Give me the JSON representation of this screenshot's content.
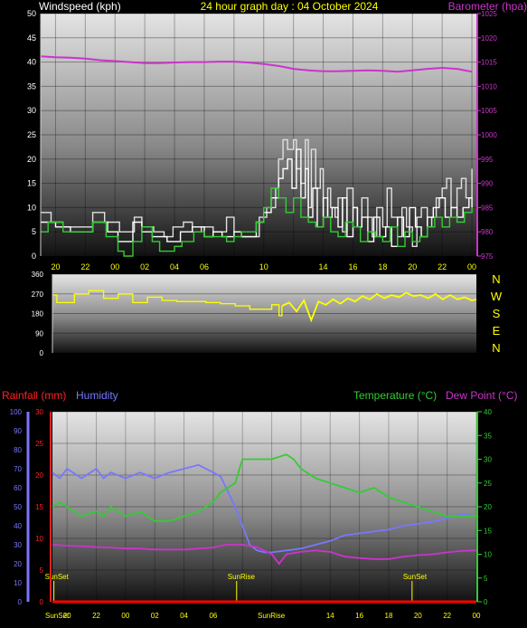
{
  "header": {
    "windspeed_label": "Windspeed (kph)",
    "title": "24 hour graph day : 04 October 2024",
    "barometer_label": "Barometer (hpa)"
  },
  "bottom_header": {
    "rainfall_label": "Rainfall (mm)",
    "humidity_label": "Humidity",
    "temperature_label": "Temperature (°C)",
    "dewpoint_label": "Dew Point (°C)"
  },
  "colors": {
    "windspeed": "#ffffff",
    "gust": "#e0e0e0",
    "avg_wind": "#33cc33",
    "barometer": "#cc33cc",
    "direction": "#ffff00",
    "rainfall": "#ff0000",
    "humidity": "#7777ff",
    "temperature": "#33cc33",
    "dewpoint": "#cc33cc",
    "tick_text": "#ffff00"
  },
  "compass": [
    "N",
    "W",
    "S",
    "E",
    "N"
  ],
  "annotations": {
    "sunset1": "SunSet",
    "sunrise": "SunRise",
    "sunset2": "SunSet"
  },
  "chart_data": [
    {
      "type": "line",
      "name": "wind-chart",
      "title": "24 hour graph day : 04 October 2024",
      "ylabel": "Windspeed (kph)",
      "y2label": "Barometer (hpa)",
      "ylim": [
        0,
        50
      ],
      "y2lim": [
        975,
        1025
      ],
      "yticks": [
        0,
        5,
        10,
        15,
        20,
        25,
        30,
        35,
        40,
        45,
        50
      ],
      "y2ticks": [
        975,
        980,
        985,
        990,
        995,
        1000,
        1005,
        1010,
        1015,
        1020,
        1025
      ],
      "xlim": [
        19,
        43
      ],
      "xticks": [
        {
          "x": 20,
          "label": "20"
        },
        {
          "x": 22,
          "label": "22"
        },
        {
          "x": 24,
          "label": "00"
        },
        {
          "x": 26,
          "label": "02"
        },
        {
          "x": 28,
          "label": "04"
        },
        {
          "x": 30,
          "label": "06"
        },
        {
          "x": 32,
          "label": "08"
        },
        {
          "x": 34,
          "label": "10"
        },
        {
          "x": 36,
          "label": "12"
        },
        {
          "x": 38,
          "label": "14"
        },
        {
          "x": 40,
          "label": "16"
        },
        {
          "x": 42,
          "label": "18"
        },
        {
          "x": 44,
          "label": "20"
        },
        {
          "x": 46,
          "label": "22"
        },
        {
          "x": 48,
          "label": "00"
        }
      ],
      "grid": true,
      "series": [
        {
          "key": "gust",
          "axis": "y",
          "step": true,
          "x": [
            19,
            19.7,
            20.5,
            22.5,
            23.3,
            24.3,
            25.3,
            25.8,
            26.6,
            27.3,
            27.9,
            28.6,
            29.2,
            29.8,
            30.6,
            31.5,
            32,
            32.5,
            33.7,
            34.2,
            34.8,
            35,
            35.3,
            35.6,
            36,
            36.2,
            36.5,
            36.8,
            37,
            37.2,
            37.5,
            37.8,
            38,
            38.3,
            38.5,
            38.8,
            39,
            39.3,
            39.6,
            40,
            40.3,
            40.6,
            41,
            41.3,
            41.6,
            42,
            42.3,
            42.6,
            43,
            43.3,
            43.6,
            44,
            44.3,
            44.6,
            45,
            45.3,
            45.6,
            46,
            46.3,
            46.6,
            47,
            47.3,
            47.6,
            48
          ],
          "y": [
            9,
            7,
            6,
            9,
            7,
            5,
            8,
            6,
            5,
            4,
            6,
            7,
            5,
            6,
            5,
            8,
            5,
            4,
            8,
            10,
            14,
            20,
            24,
            22,
            24,
            18,
            15,
            24,
            10,
            22,
            14,
            18,
            8,
            14,
            10,
            8,
            12,
            5,
            14,
            10,
            6,
            12,
            8,
            4,
            10,
            6,
            14,
            8,
            4,
            10,
            6,
            2,
            8,
            10,
            6,
            8,
            12,
            14,
            16,
            10,
            14,
            16,
            12,
            18
          ]
        },
        {
          "key": "windspeed",
          "axis": "y",
          "step": true,
          "x": [
            19,
            20,
            21,
            22.5,
            23.5,
            24.2,
            25.2,
            25.8,
            26.5,
            27.5,
            28.4,
            29.2,
            30,
            30.6,
            31.2,
            32,
            32.5,
            33.5,
            34,
            34.5,
            35,
            35.3,
            35.6,
            35.9,
            36.2,
            36.5,
            36.8,
            37,
            37.3,
            37.6,
            38,
            38.3,
            38.6,
            39,
            39.3,
            39.6,
            40,
            40.3,
            40.6,
            41,
            41.4,
            41.8,
            42.2,
            42.6,
            43,
            43.4,
            43.8,
            44.2,
            44.6,
            45,
            45.4,
            45.8,
            46.2,
            46.6,
            47,
            47.4,
            47.8,
            48
          ],
          "y": [
            7,
            6,
            5,
            7,
            5,
            3,
            7,
            5,
            4,
            3,
            5,
            6,
            4,
            5,
            4,
            5,
            4,
            7,
            9,
            12,
            16,
            18,
            20,
            14,
            22,
            12,
            18,
            8,
            14,
            6,
            12,
            8,
            10,
            6,
            12,
            4,
            10,
            6,
            8,
            3,
            8,
            4,
            6,
            2,
            8,
            4,
            10,
            6,
            4,
            8,
            10,
            12,
            8,
            10,
            8,
            10,
            12,
            10
          ]
        },
        {
          "key": "avg_wind",
          "axis": "y",
          "step": true,
          "x": [
            19,
            19.5,
            20.5,
            22.5,
            23.4,
            24.2,
            24.6,
            25.2,
            25.8,
            26.5,
            27,
            28,
            28.5,
            29.3,
            30,
            31.5,
            32,
            32.5,
            33.5,
            34,
            34.5,
            35,
            35.5,
            36,
            36.5,
            37,
            37.5,
            38,
            38.5,
            39,
            39.5,
            40,
            40.5,
            41,
            41.5,
            42,
            42.5,
            43,
            43.5,
            44,
            44.5,
            45,
            45.5,
            46,
            46.5,
            47,
            47.5,
            48
          ],
          "y": [
            5,
            7,
            5,
            7,
            4,
            1,
            0,
            3,
            6,
            3,
            1,
            2,
            3,
            5,
            4,
            3,
            4,
            5,
            7,
            10,
            14,
            12,
            9,
            12,
            8,
            7,
            6,
            8,
            5,
            4,
            7,
            6,
            3,
            5,
            4,
            3,
            6,
            2,
            5,
            3,
            4,
            6,
            8,
            6,
            8,
            7,
            9,
            10
          ]
        },
        {
          "key": "barometer",
          "axis": "y2",
          "x": [
            19,
            20,
            21,
            22,
            23,
            24,
            25,
            26,
            27,
            28,
            29,
            30,
            31,
            32,
            33,
            34,
            35,
            36,
            37,
            38,
            39,
            40,
            41,
            42,
            43,
            44,
            45,
            46,
            47,
            48
          ],
          "y": [
            1016.2,
            1016.0,
            1015.9,
            1015.7,
            1015.4,
            1015.2,
            1015.0,
            1014.8,
            1014.8,
            1014.9,
            1015.0,
            1015.0,
            1015.1,
            1015.1,
            1014.9,
            1014.6,
            1014.2,
            1013.6,
            1013.3,
            1013.1,
            1013.1,
            1013.2,
            1013.3,
            1013.2,
            1013.0,
            1013.3,
            1013.6,
            1013.8,
            1013.6,
            1013.0
          ]
        }
      ]
    },
    {
      "type": "line",
      "name": "direction-chart",
      "ylim": [
        0,
        360
      ],
      "yticks": [
        0,
        90,
        180,
        270,
        360
      ],
      "xlim": [
        19,
        48
      ],
      "series": [
        {
          "key": "direction",
          "step": true,
          "x": [
            19,
            19.3,
            20.5,
            21.5,
            22.5,
            23.5,
            24.5,
            25.5,
            26.5,
            27.5,
            28.5,
            29.5,
            30.5,
            31.5,
            32.5,
            33.5,
            34,
            34.5,
            34.7
          ],
          "y": [
            265,
            230,
            270,
            285,
            250,
            270,
            230,
            255,
            240,
            235,
            235,
            230,
            225,
            215,
            200,
            200,
            220,
            170,
            215
          ]
        },
        {
          "key": "direction_noisy",
          "x": [
            34.7,
            35.2,
            35.7,
            36.2,
            36.7,
            37.2,
            37.7,
            38.2,
            38.7,
            39.2,
            39.7,
            40.2,
            40.7,
            41.2,
            41.7,
            42.2,
            42.7,
            43.2,
            43.7,
            44.2,
            44.7,
            45.2,
            45.7,
            46.2,
            46.7,
            47.2,
            47.7,
            48
          ],
          "y": [
            215,
            230,
            190,
            240,
            150,
            235,
            220,
            245,
            225,
            250,
            235,
            260,
            245,
            270,
            250,
            265,
            255,
            275,
            260,
            265,
            250,
            270,
            245,
            265,
            245,
            255,
            240,
            245
          ]
        }
      ]
    },
    {
      "type": "line",
      "name": "temp-humidity-chart",
      "ylabel": "Rainfall (mm)",
      "y2label": "Temperature (°C)",
      "humidity_ylim": [
        0,
        100
      ],
      "humidity_yticks": [
        0,
        10,
        20,
        30,
        40,
        50,
        60,
        70,
        80,
        90,
        100
      ],
      "rain_ylim": [
        0,
        30
      ],
      "rain_yticks": [
        0,
        5,
        10,
        15,
        20,
        25,
        30
      ],
      "temp_ylim": [
        0,
        40
      ],
      "temp_yticks": [
        0,
        5,
        10,
        15,
        20,
        25,
        30,
        35,
        40
      ],
      "xlim": [
        19,
        48
      ],
      "xticks": [
        {
          "x": 20,
          "label": "20"
        },
        {
          "x": 22,
          "label": "22"
        },
        {
          "x": 24,
          "label": "00"
        },
        {
          "x": 26,
          "label": "02"
        },
        {
          "x": 28,
          "label": "04"
        },
        {
          "x": 30,
          "label": "06"
        },
        {
          "x": 32,
          "label": "08"
        },
        {
          "x": 34,
          "label": "10"
        },
        {
          "x": 36,
          "label": "12"
        },
        {
          "x": 38,
          "label": "14"
        },
        {
          "x": 40,
          "label": "16"
        },
        {
          "x": 42,
          "label": "18"
        },
        {
          "x": 44,
          "label": "20"
        },
        {
          "x": 46,
          "label": "22"
        },
        {
          "x": 48,
          "label": "00"
        }
      ],
      "sun_events": [
        {
          "x": 19.1,
          "key": "sunset1"
        },
        {
          "x": 31.6,
          "key": "sunrise"
        },
        {
          "x": 43.6,
          "key": "sunset2"
        }
      ],
      "series": [
        {
          "key": "humidity",
          "axis": "humidity",
          "x": [
            19,
            19.5,
            20,
            21,
            22,
            22.5,
            23,
            24,
            25,
            26,
            27,
            28,
            29,
            29.5,
            30,
            30.5,
            31,
            31.5,
            32,
            32.5,
            33,
            33.5,
            34,
            35,
            36,
            37,
            38,
            39,
            40,
            41,
            42,
            43,
            44,
            45,
            46,
            47,
            48
          ],
          "y": [
            68,
            65,
            70,
            65,
            70,
            65,
            68,
            65,
            68,
            65,
            68,
            70,
            72,
            70,
            68,
            66,
            58,
            50,
            40,
            30,
            27,
            26,
            26,
            27,
            28,
            30,
            32,
            35,
            36,
            37,
            38,
            40,
            41,
            42,
            44,
            46,
            45
          ]
        },
        {
          "key": "temperature",
          "axis": "temp",
          "x": [
            19,
            19.5,
            20,
            21,
            22,
            22.5,
            23,
            24,
            25,
            26,
            27,
            28,
            29,
            29.5,
            30,
            30.5,
            31,
            31.5,
            32,
            32.5,
            33,
            34,
            35,
            35.5,
            36,
            37,
            38,
            39,
            40,
            41,
            42,
            43,
            44,
            45,
            46,
            47,
            48
          ],
          "y": [
            20,
            21,
            20,
            18,
            19,
            18,
            20,
            18,
            19,
            17,
            17,
            18,
            19,
            20,
            21,
            23,
            24,
            25,
            30,
            30,
            30,
            30,
            31,
            30,
            28,
            26,
            25,
            24,
            23,
            24,
            22,
            21,
            20,
            19,
            18,
            18,
            18
          ]
        },
        {
          "key": "dewpoint",
          "axis": "temp",
          "x": [
            19,
            20,
            21,
            22,
            23,
            24,
            25,
            26,
            27,
            28,
            29,
            30,
            30.5,
            31,
            32,
            33,
            34,
            34.5,
            35,
            36,
            37,
            38,
            39,
            40,
            41,
            42,
            43,
            44,
            45,
            46,
            47,
            48
          ],
          "y": [
            12,
            11.8,
            11.7,
            11.5,
            11.4,
            11.2,
            11.2,
            11,
            11,
            11,
            11.2,
            11.4,
            11.8,
            12,
            12,
            11.5,
            10,
            8,
            10,
            10.5,
            10.8,
            10.5,
            9.5,
            9.2,
            9,
            9,
            9.5,
            9.8,
            10,
            10.4,
            10.7,
            10.8
          ]
        },
        {
          "key": "rainfall",
          "axis": "rain",
          "x": [
            19,
            48
          ],
          "y": [
            0,
            0
          ]
        }
      ]
    }
  ]
}
